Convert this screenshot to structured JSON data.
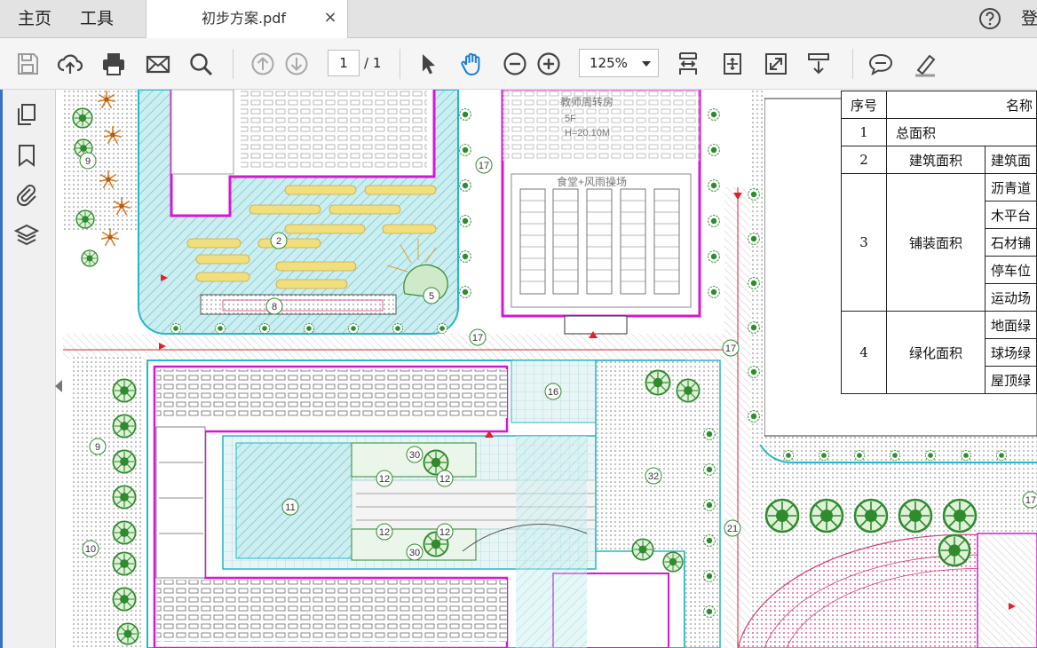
{
  "nav": {
    "home": "主页",
    "tools": "工具",
    "login": "登"
  },
  "tab": {
    "title": "初步方案.pdf",
    "close": "×"
  },
  "toolbar": {
    "page_current": "1",
    "page_total": "/ 1",
    "zoom": "125%"
  },
  "icons": {
    "save": "save-icon",
    "upload": "upload-icon",
    "print": "print-icon",
    "email": "email-icon",
    "search": "search-icon",
    "prev": "arrow-up-icon",
    "next": "arrow-down-icon",
    "select": "pointer-icon",
    "hand": "hand-icon",
    "zoom_out": "zoom-out-icon",
    "zoom_in": "zoom-in-icon",
    "fit": "fit-page-icon",
    "rotate": "rotate-icon",
    "fullscreen": "fullscreen-icon",
    "scroll": "scroll-mode-icon",
    "comment": "comment-icon",
    "highlight": "highlight-icon",
    "help": "help-icon",
    "pages": "pages-icon",
    "bookmark": "bookmark-icon",
    "attach": "attachment-icon",
    "layers": "layers-icon"
  },
  "colors": {
    "accent": "#3a6fc4",
    "magenta": "#d417d4",
    "cyan": "#23b7c7",
    "green": "#2e8b2e",
    "red": "#e0202a"
  },
  "table": {
    "header_no": "序号",
    "header_name": "名称",
    "r1_no": "1",
    "r1_cat": "总面积",
    "r2_no": "2",
    "r2_cat": "建筑面积",
    "r2_sub": "建筑面",
    "r3_no": "3",
    "r3_cat": "铺装面积",
    "r3_subs": [
      "沥青道",
      "木平台",
      "石材铺",
      "停车位",
      "运动场"
    ],
    "r4_no": "4",
    "r4_cat": "绿化面积",
    "r4_subs": [
      "地面绿",
      "球场绿",
      "屋顶绿"
    ]
  },
  "plan": {
    "building_top": "教师周转房",
    "building_floors": "5F",
    "building_height": "H=20.10M",
    "canteen": "食堂+风雨操场",
    "labels": [
      "9",
      "2",
      "5",
      "8",
      "17",
      "17",
      "17",
      "16",
      "9",
      "10",
      "11",
      "12",
      "12",
      "12",
      "12",
      "30",
      "30",
      "32",
      "21",
      "17"
    ]
  }
}
